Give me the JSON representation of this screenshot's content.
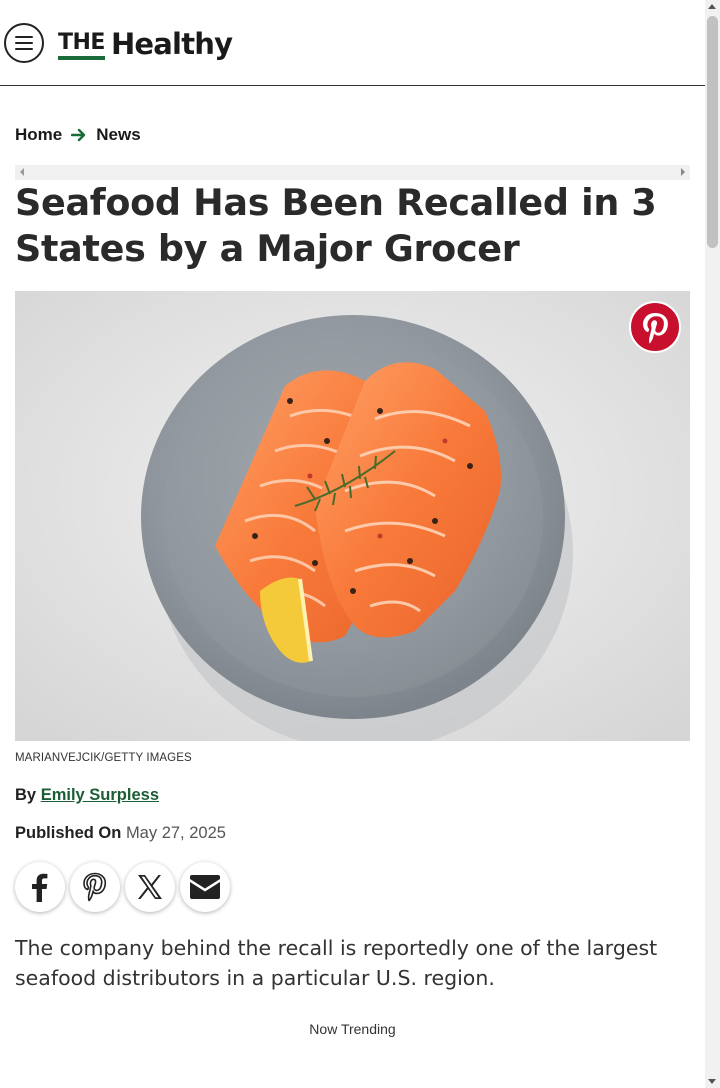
{
  "header": {
    "menu_icon": "hamburger-menu-icon",
    "logo": {
      "the": "THE",
      "healthy": "Healthy"
    },
    "colors": {
      "brand_green": "#1b6b3a",
      "pinterest_red": "#c8102e"
    }
  },
  "breadcrumb": {
    "items": [
      {
        "label": "Home"
      },
      {
        "label": "News"
      }
    ],
    "separator_icon": "arrow-right-icon"
  },
  "article": {
    "title": "Seafood Has Been Recalled in 3 States by a Major Grocer",
    "hero_alt_icon": "salmon-fillets-plate-image",
    "photo_credit": "MARIANVEJCIK/GETTY IMAGES",
    "byline_prefix": "By",
    "author": "Emily Surpless",
    "published_label": "Published On",
    "published_date": "May 27, 2025",
    "dek": "The company behind the recall is reportedly one of the largest seafood distributors in a particular U.S. region."
  },
  "share": {
    "buttons": [
      {
        "icon": "facebook-icon"
      },
      {
        "icon": "pinterest-icon"
      },
      {
        "icon": "x-twitter-icon"
      },
      {
        "icon": "email-icon"
      }
    ]
  },
  "trending": {
    "label": "Now Trending"
  }
}
